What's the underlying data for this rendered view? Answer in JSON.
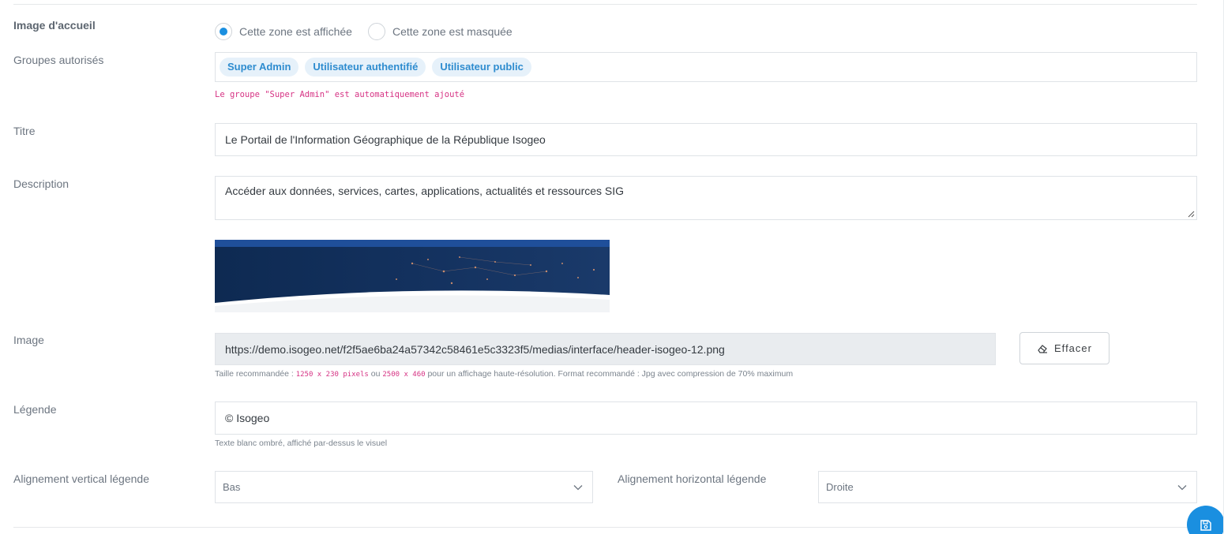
{
  "image_accueil": {
    "label": "Image d'accueil",
    "options": [
      "Cette zone est affichée",
      "Cette zone est masquée"
    ],
    "selected": 0
  },
  "groupes": {
    "label": "Groupes autorisés",
    "chips": [
      "Super Admin",
      "Utilisateur authentifié",
      "Utilisateur public"
    ],
    "note": "Le groupe \"Super Admin\" est automatiquement ajouté"
  },
  "titre": {
    "label": "Titre",
    "value": "Le Portail de l'Information Géographique de la République Isogeo"
  },
  "description": {
    "label": "Description",
    "value": "Accéder aux données, services, cartes, applications, actualités et ressources SIG"
  },
  "image": {
    "label": "Image",
    "value": "https://demo.isogeo.net/f2f5ae6ba24a57342c58461e5c3323f5/medias/interface/header-isogeo-12.png",
    "clear_button": "Effacer",
    "help_prefix": "Taille recommandée : ",
    "help_size1": "1250 x 230 pixels",
    "help_or": " ou ",
    "help_size2": "2500 x 460",
    "help_suffix": " pour un affichage haute-résolution. Format recommandé : Jpg avec compression de 70% maximum"
  },
  "legende": {
    "label": "Légende",
    "value": "© Isogeo",
    "help": "Texte blanc ombré, affiché par-dessus le visuel"
  },
  "alignement_vertical": {
    "label": "Alignement vertical légende",
    "value": "Bas"
  },
  "alignement_horizontal": {
    "label": "Alignement horizontal légende",
    "value": "Droite"
  },
  "colors": {
    "accent": "#1a8fe0",
    "chip_bg": "#e6f1fa",
    "chip_text": "#2e8ccf",
    "note": "#d63384"
  }
}
